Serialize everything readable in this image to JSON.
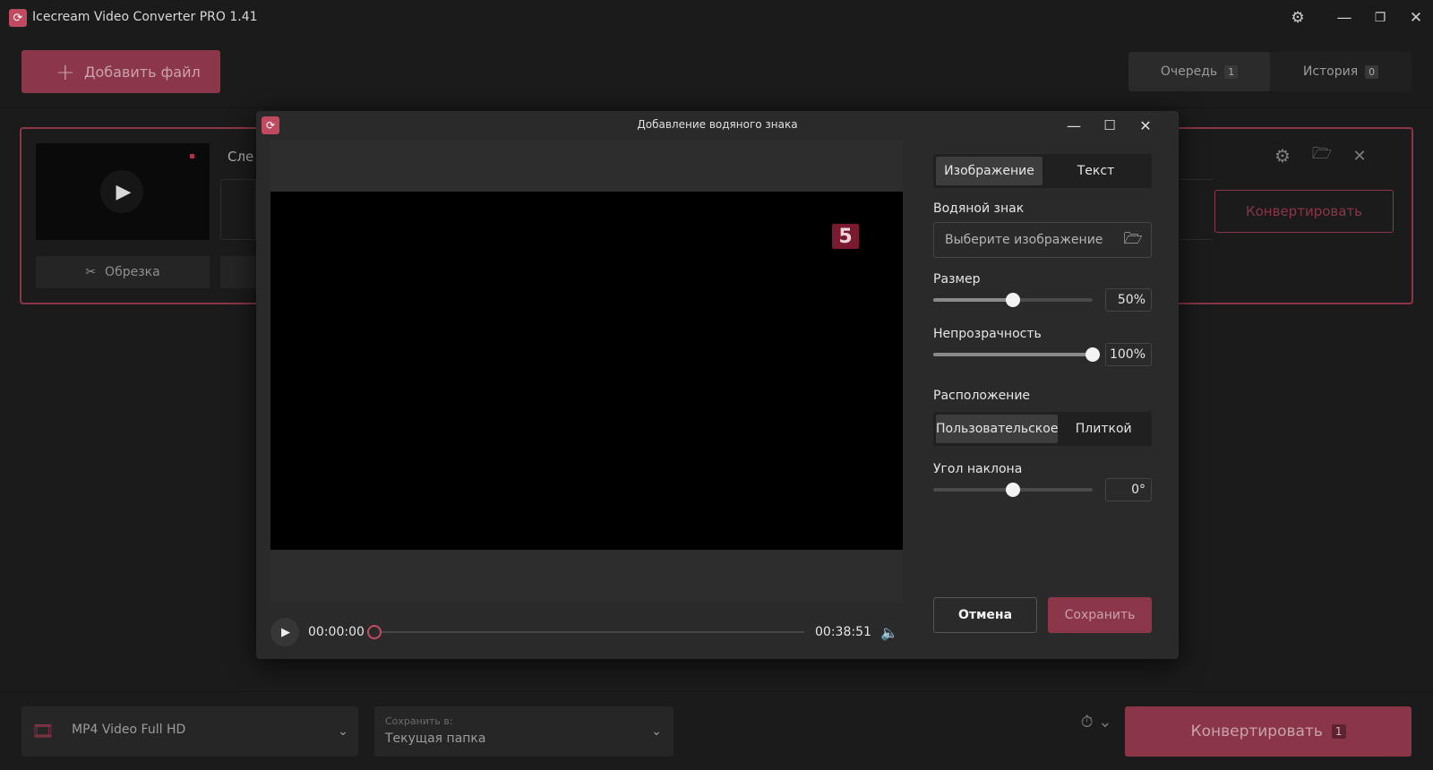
{
  "app": {
    "title": "Icecream Video Converter PRO 1.41",
    "accent": "#8a3548"
  },
  "toolbar": {
    "add_file_label": "Добавить файл"
  },
  "tabs": [
    {
      "label": "Очередь",
      "count": "1"
    },
    {
      "label": "История",
      "count": "0"
    }
  ],
  "file_card": {
    "partial_text": "Сле",
    "trim_label": "Обрезка",
    "convert_label": "Конвертировать"
  },
  "dialog": {
    "title": "Добавление водяного знака",
    "watermark_glyph": "5",
    "mode_tabs": [
      "Изображение",
      "Текст"
    ],
    "watermark_label": "Водяной знак",
    "image_placeholder": "Выберите изображение",
    "size_label": "Размер",
    "size_value": "50%",
    "size_fraction": 0.5,
    "opacity_label": "Непрозрачность",
    "opacity_value": "100%",
    "opacity_fraction": 1.0,
    "position_label": "Расположение",
    "position_tabs": [
      "Пользовательское",
      "Плиткой"
    ],
    "angle_label": "Угол наклона",
    "angle_value": "0°",
    "angle_fraction": 0.5,
    "cancel_label": "Отмена",
    "save_label": "Сохранить",
    "player": {
      "current_time": "00:00:00",
      "total_time": "00:38:51",
      "progress": 0
    }
  },
  "bottom": {
    "format_label": "MP4 Video Full HD",
    "save_to_label": "Сохранить в:",
    "save_to_value": "Текущая папка",
    "convert_label": "Конвертировать",
    "convert_count": "1"
  }
}
